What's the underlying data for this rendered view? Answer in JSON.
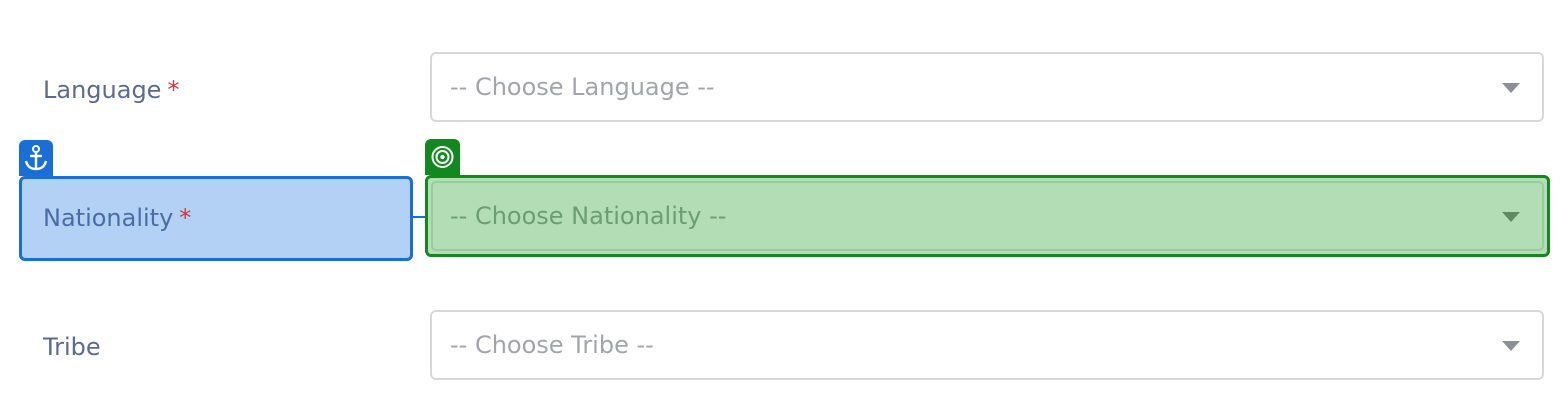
{
  "form": {
    "language": {
      "label": "Language",
      "required_mark": "*",
      "placeholder": "-- Choose Language --"
    },
    "nationality": {
      "label": "Nationality",
      "required_mark": "*",
      "placeholder": "-- Choose Nationality --"
    },
    "tribe": {
      "label": "Tribe",
      "placeholder": "-- Choose Tribe --"
    }
  },
  "overlay": {
    "anchor_icon": "anchor-icon",
    "target_icon": "target-icon",
    "anchor_color": "#1a6fd6",
    "target_color": "#12891f"
  }
}
